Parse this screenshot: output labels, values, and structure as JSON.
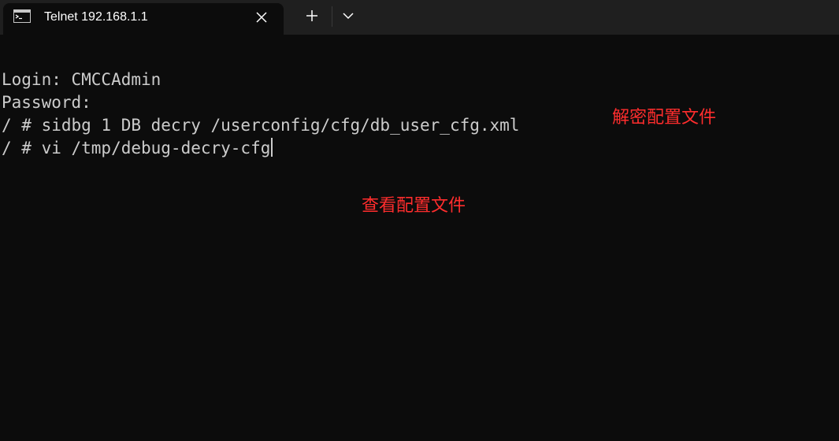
{
  "tab": {
    "title": "Telnet 192.168.1.1",
    "icon": "terminal-icon"
  },
  "tabstrip": {
    "close_icon": "close-icon",
    "new_tab_icon": "plus-icon",
    "dropdown_icon": "chevron-down-icon"
  },
  "terminal": {
    "lines": [
      "Login: CMCCAdmin",
      "Password:",
      "/ # sidbg 1 DB decry /userconfig/cfg/db_user_cfg.xml",
      "/ # vi /tmp/debug-decry-cfg"
    ]
  },
  "annotations": {
    "decrypt_note": "解密配置文件",
    "view_note": "查看配置文件",
    "color": "#ff2d2d"
  },
  "colors": {
    "background": "#0c0c0c",
    "tabstrip": "#1f1f1f",
    "text": "#cccccc"
  }
}
